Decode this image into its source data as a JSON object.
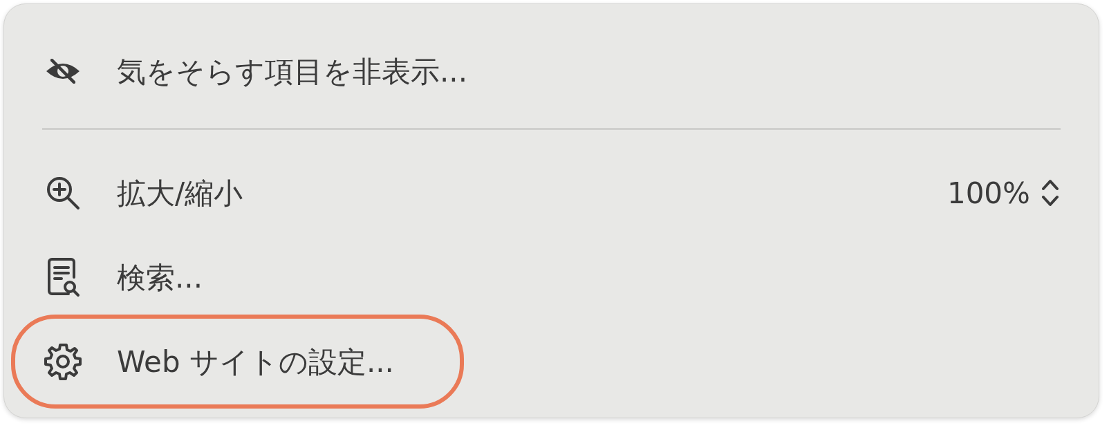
{
  "menu": {
    "items": [
      {
        "kind": "item",
        "label": "気をそらす項目を非表示...",
        "highlighted": false
      },
      {
        "kind": "separator"
      },
      {
        "kind": "item",
        "label": "拡大/縮小",
        "value": "100%",
        "highlighted": false
      },
      {
        "kind": "item",
        "label": "検索...",
        "highlighted": false
      },
      {
        "kind": "item",
        "label": "Web サイトの設定...",
        "highlighted": true
      }
    ]
  }
}
